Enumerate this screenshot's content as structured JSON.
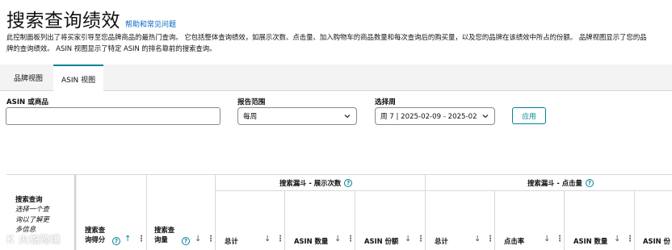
{
  "page": {
    "title": "搜索查询绩效",
    "help_link": "帮助和常见问题",
    "description": "此控制面板列出了将买家引导至您品牌商品的最热门查询。 它包括整体查询绩效，如展示次数、点击量、加入购物车的商品数量和每次查询后的购买量，以及您的品牌在该绩效中所占的份额。 品牌视图显示了您的品牌的查询绩效。 ASIN 视图显示了特定 ASIN 的排名靠前的搜索查询。"
  },
  "tabs": [
    {
      "label": "品牌视图",
      "active": false
    },
    {
      "label": "ASIN 视图",
      "active": true
    }
  ],
  "filters": {
    "asin_label": "ASIN 或商品",
    "asin_value": "",
    "range_label": "报告范围",
    "range_value": "每周",
    "week_label": "选择周",
    "week_value": "周 7 | 2025-02-09 - 2025-02",
    "apply_label": "应用"
  },
  "table": {
    "search_query_title": "搜索查询",
    "search_query_hint": "选择一个查询以了解更多信息",
    "score_label": "搜索查询得分",
    "volume_label": "搜索查询量",
    "impressions_group": "搜索漏斗 - 展示次数",
    "clicks_group": "搜索漏斗 - 点击量",
    "columns": {
      "imp_total": "总计",
      "imp_asin_count": "ASIN 数量",
      "imp_asin_share": "ASIN 份额",
      "clk_total": "总计",
      "clk_rate": "点击率",
      "clk_asin_count": "ASIN 数量",
      "clk_asin_share": "ASIN 份"
    }
  },
  "watermark": "K 火蛇跨境"
}
